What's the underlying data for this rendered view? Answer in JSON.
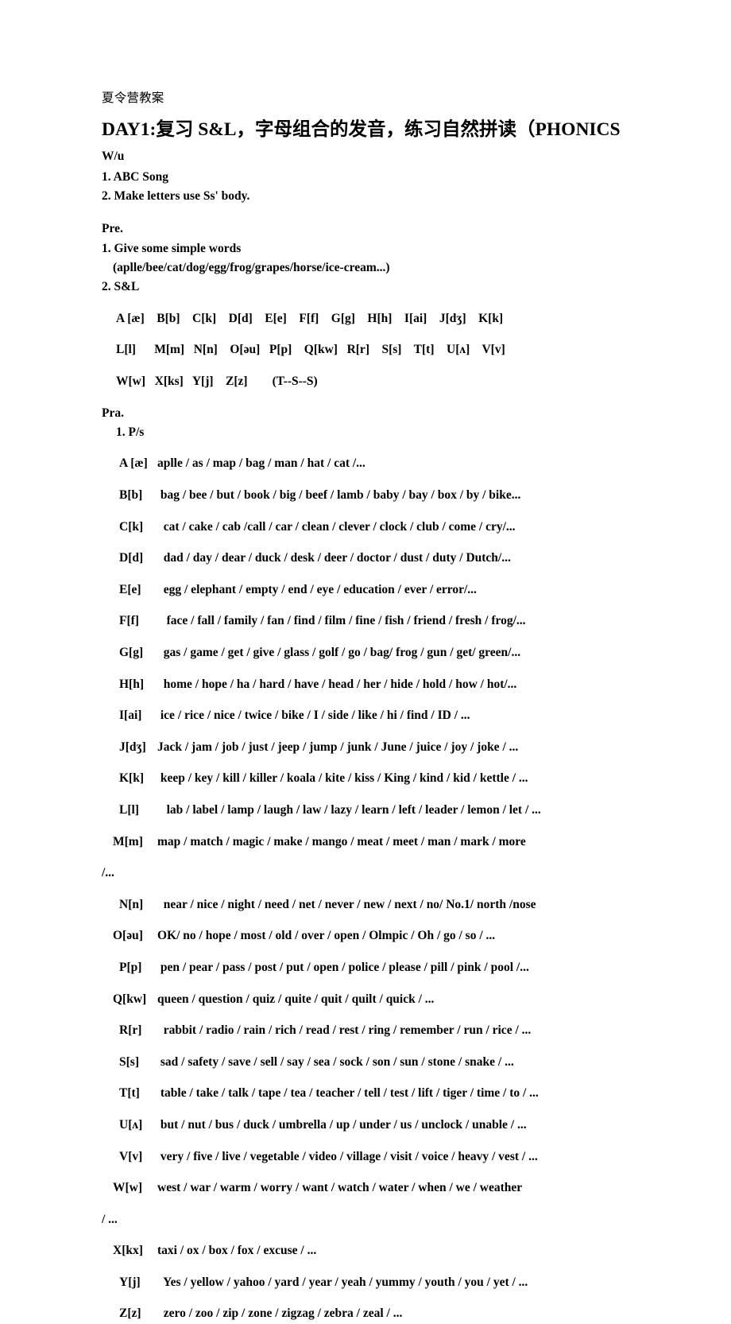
{
  "document": {
    "subject": "夏令营教案",
    "title": "DAY1:复习 S&L，字母组合的发音，练习自然拼读（PHONICS",
    "title_wrap": "W/u"
  },
  "warmup": {
    "items": [
      "1. ABC Song",
      "2. Make letters use Ss' body."
    ]
  },
  "presentation": {
    "heading": "Pre.",
    "item1": "1. Give some simple words",
    "item1_examples": "(aplle/bee/cat/dog/egg/frog/grapes/horse/ice-cream...)",
    "item2": "2. S&L",
    "alphabet_rows": [
      "A [æ]    B[b]    C[k]    D[d]    E[e]    F[f]    G[g]    H[h]    I[ai]    J[dʒ]    K[k]",
      "L[l]      M[m]   N[n]    O[əu]   P[p]    Q[kw]   R[r]    S[s]    T[t]    U[ʌ]    V[v]",
      "W[w]   X[ks]   Y[j]    Z[z]        (T--S--S)"
    ]
  },
  "practice": {
    "heading": "Pra.",
    "subheading": "1. P/s",
    "rows": [
      {
        "label": "A [æ]",
        "words": "aplle / as / map / bag / man / hat / cat /...",
        "wide": false,
        "continuation": null
      },
      {
        "label": "B[b]",
        "words": " bag / bee / but / book / big / beef / lamb / baby / bay / box / by / bike...",
        "wide": false,
        "continuation": null
      },
      {
        "label": "C[k]",
        "words": "  cat / cake / cab /call / car / clean / clever / clock / club / come / cry/...",
        "wide": false,
        "continuation": null
      },
      {
        "label": "D[d]",
        "words": "  dad / day / dear / duck / desk / deer / doctor / dust / duty / Dutch/...",
        "wide": false,
        "continuation": null
      },
      {
        "label": "E[e]",
        "words": "  egg / elephant / empty / end / eye / education / ever / error/...",
        "wide": false,
        "continuation": null
      },
      {
        "label": "F[f]",
        "words": "   face / fall / family / fan / find / film / fine / fish / friend / fresh / frog/...",
        "wide": false,
        "continuation": null
      },
      {
        "label": "G[g]",
        "words": "  gas / game / get / give / glass / golf / go / bag/ frog / gun / get/ green/...",
        "wide": false,
        "continuation": null
      },
      {
        "label": "H[h]",
        "words": "  home / hope / ha / hard / have / head / her / hide / hold / how / hot/...",
        "wide": false,
        "continuation": null
      },
      {
        "label": "I[ai]",
        "words": " ice / rice / nice / twice / bike / I / side / like / hi / find / ID / ...",
        "wide": false,
        "continuation": null
      },
      {
        "label": "J[dʒ]",
        "words": "Jack / jam / job / just / jeep / jump / junk / June / juice / joy / joke / ...",
        "wide": false,
        "continuation": null
      },
      {
        "label": "K[k]",
        "words": " keep / key / kill / killer / koala / kite / kiss / King / kind / kid / kettle / ...",
        "wide": false,
        "continuation": null
      },
      {
        "label": "L[l]",
        "words": "   lab / label / lamp / laugh / law / lazy / learn / left / leader / lemon / let / ...",
        "wide": false,
        "continuation": null
      },
      {
        "label": "M[m]",
        "words": "map / match / magic / make / mango / meat / meet / man / mark / more",
        "wide": true,
        "continuation": "/..."
      },
      {
        "label": "N[n]",
        "words": "  near / nice / night / need / net / never / new / next / no/ No.1/ north /nose",
        "wide": false,
        "continuation": null
      },
      {
        "label": "O[əu]",
        "words": "OK/ no / hope / most / old / over / open / Olmpic / Oh / go / so / ...",
        "wide": true,
        "continuation": null
      },
      {
        "label": "P[p]",
        "words": " pen / pear / pass / post / put / open / police / please / pill / pink / pool /...",
        "wide": false,
        "continuation": null
      },
      {
        "label": "Q[kw]",
        "words": "queen / question / quiz / quite / quit / quilt / quick / ...",
        "wide": true,
        "continuation": null
      },
      {
        "label": "R[r]",
        "words": "  rabbit / radio / rain / rich / read / rest / ring / remember / run / rice / ...",
        "wide": false,
        "continuation": null
      },
      {
        "label": "S[s]",
        "words": " sad / safety / save / sell / say / sea / sock / son / sun / stone / snake / ...",
        "wide": false,
        "continuation": null
      },
      {
        "label": "T[t]",
        "words": " table / take / talk / tape / tea / teacher / tell / test / lift / tiger / time / to / ...",
        "wide": false,
        "continuation": null
      },
      {
        "label": "U[ʌ]",
        "words": " but / nut / bus / duck / umbrella / up / under / us / unclock / unable / ...",
        "wide": false,
        "continuation": null
      },
      {
        "label": "V[v]",
        "words": " very / five / live / vegetable / video / village / visit / voice / heavy / vest / ...",
        "wide": false,
        "continuation": null
      },
      {
        "label": "W[w]",
        "words": "west / war / warm / worry / want / watch / water / when / we / weather",
        "wide": true,
        "continuation": "/ ..."
      },
      {
        "label": "X[kx]",
        "words": "taxi / ox / box / fox / excuse / ...",
        "wide": true,
        "continuation": null
      },
      {
        "label": "Y[j]",
        "words": "  Yes / yellow / yahoo / yard / year / yeah / yummy / youth / you / yet / ...",
        "wide": false,
        "continuation": null
      },
      {
        "label": "Z[z]",
        "words": "  zero / zoo / zip / zone / zigzag / zebra / zeal / ...",
        "wide": false,
        "continuation": null
      }
    ]
  }
}
